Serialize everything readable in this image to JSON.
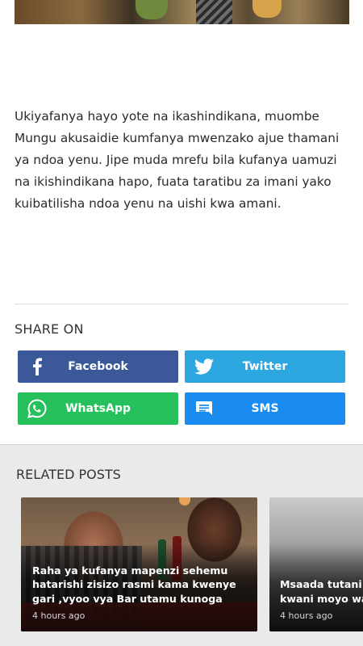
{
  "article": {
    "body": "Ukiyafanya hayo yote na ikashindikana, muombe Mungu akusaidie kumfanya mwenzako ajue thamani ya ndoa yenu. Jipe muda mrefu bila kufanya uamuzi na ikishindikana hapo, fuata taratibu za imani yako kuibatilisha ndoa yenu na uishi kwa amani."
  },
  "share": {
    "title": "SHARE ON",
    "buttons": [
      {
        "label": "Facebook",
        "icon": "facebook-icon",
        "color": "#3b5998"
      },
      {
        "label": "Twitter",
        "icon": "twitter-icon",
        "color": "#2ca7e0"
      },
      {
        "label": "WhatsApp",
        "icon": "whatsapp-icon",
        "color": "#26c15c"
      },
      {
        "label": "SMS",
        "icon": "sms-icon",
        "color": "#1a8cf0"
      }
    ]
  },
  "related": {
    "title": "RELATED POSTS",
    "posts": [
      {
        "title": "Raha ya kufanya mapenzi sehemu hatarishi zisizo rasmi kama kwenye gari ,vyoo vya Bar utamu kunoga",
        "time": "4 hours ago"
      },
      {
        "title": "Msaada tutani : k kwani moyo wan",
        "time": "4 hours ago"
      }
    ]
  }
}
